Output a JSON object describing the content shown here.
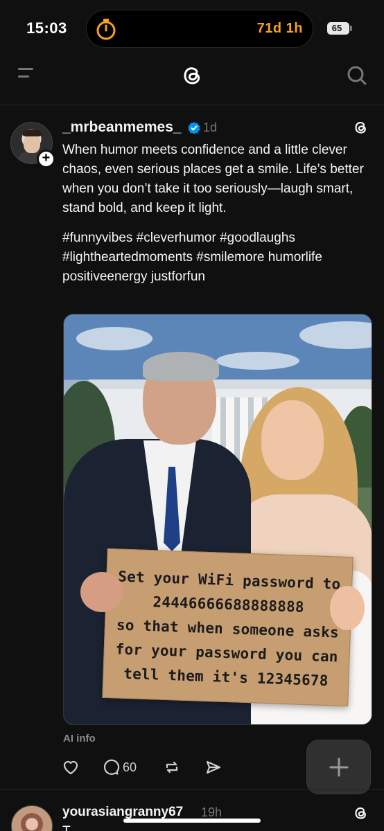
{
  "status_bar": {
    "time": "15:03",
    "timer_icon": "stopwatch-icon",
    "timer_text": "71d 1h",
    "battery_level": "65",
    "colors": {
      "timer_accent": "#f7a21b"
    }
  },
  "top_nav": {
    "menu_icon": "menu-icon",
    "logo_icon": "threads-logo-icon",
    "search_icon": "search-icon"
  },
  "post": {
    "username": "_mrbeanmemes_",
    "time": "1d",
    "verified_icon": "verified-check-icon",
    "follow_icon": "plus-icon",
    "paragraph_1": "When humor meets confidence and a little clever chaos, even serious places get a smile. Life’s better when you don’t take it too seriously—laugh smart, stand bold, and keep it light.",
    "paragraph_2": "#funnyvibes #cleverhumor #goodlaughs #lightheartedmoments #smilemore humorlife positiveenergy justforfun",
    "image_sign": {
      "line_1": "Set your WiFi password to",
      "line_2": "24446666688888888",
      "line_3": "so that when someone asks",
      "line_4": "for your password you can",
      "line_5": "tell them it's 12345678"
    },
    "ai_label": "AI info",
    "actions": {
      "like_icon": "heart-icon",
      "comment_icon": "comment-icon",
      "comment_count": "60",
      "repost_icon": "repost-icon",
      "share_icon": "share-icon"
    }
  },
  "fab": {
    "icon": "plus-icon"
  },
  "next_post": {
    "username": "yourasiangranny67",
    "time": "19h",
    "text_preview": "T"
  }
}
